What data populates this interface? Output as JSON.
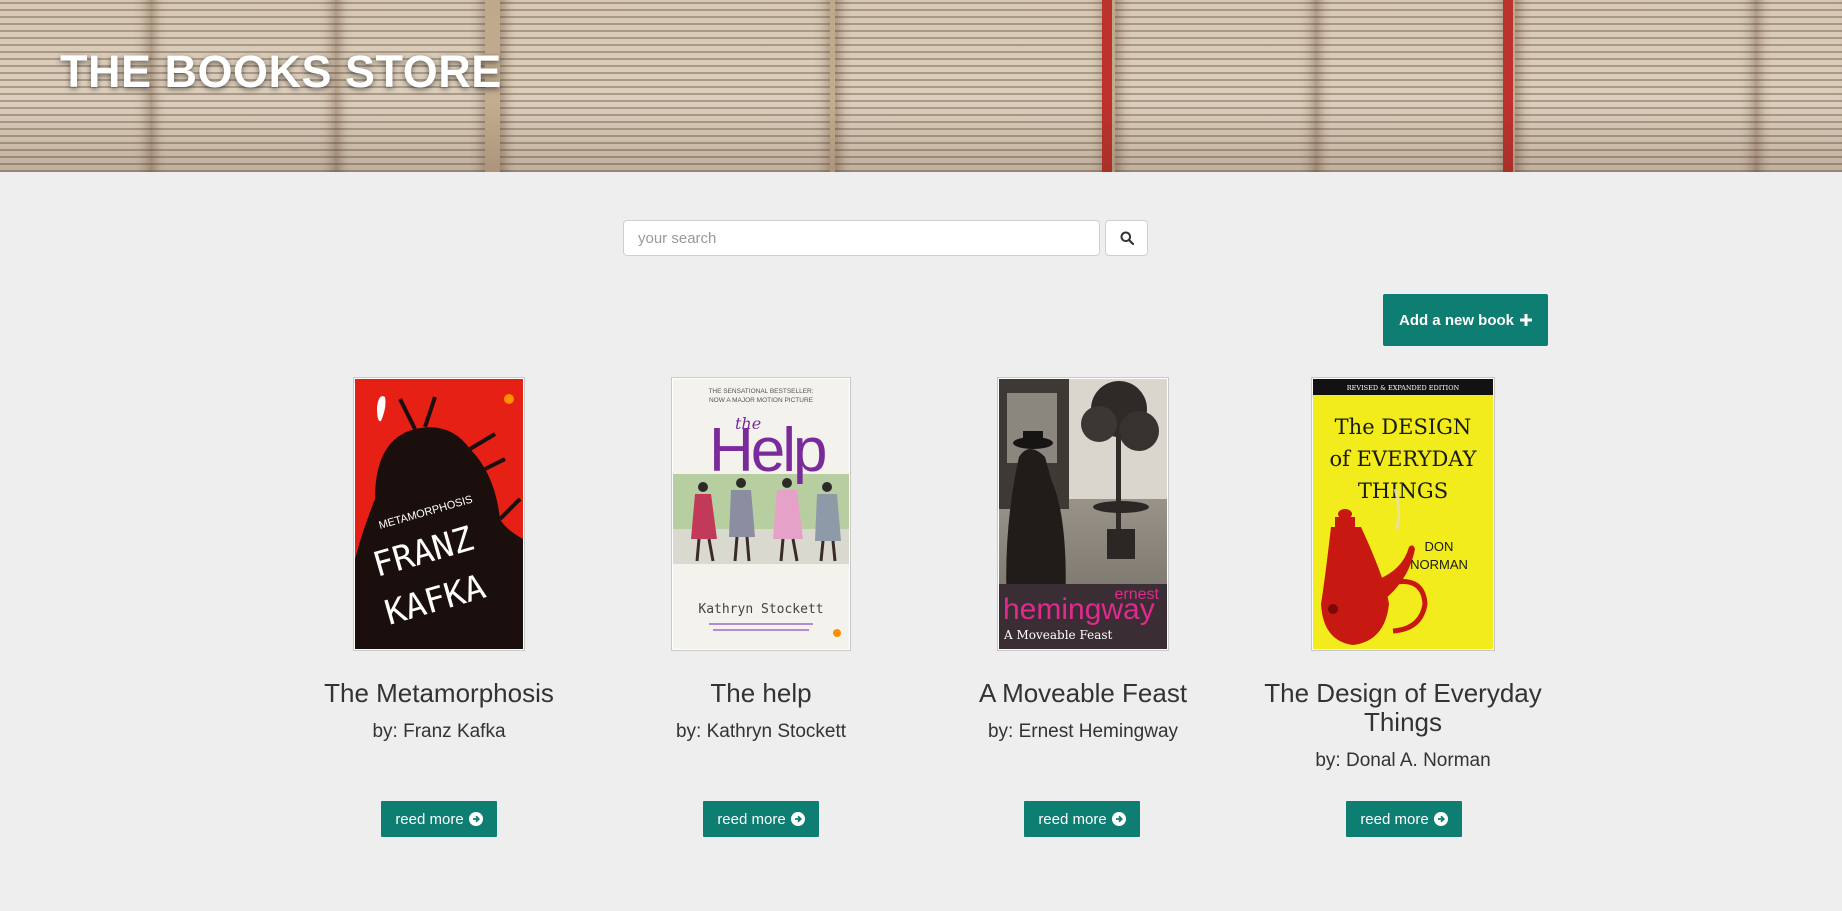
{
  "header": {
    "title": "THE BOOKS STORE"
  },
  "search": {
    "placeholder": "your search",
    "icon": "search-icon"
  },
  "actions": {
    "add_book_label": "Add a new book",
    "add_icon": "plus-icon"
  },
  "colors": {
    "accent": "#0e7d72",
    "page_background": "#eeeeee"
  },
  "books": [
    {
      "title": "The Metamorphosis",
      "author": "by: Franz Kafka",
      "button": "reed more",
      "cover": {
        "series_label": "METAMORPHOSIS",
        "author_line1": "FRANZ",
        "author_line2": "KAFKA"
      }
    },
    {
      "title": "The help",
      "author": "by: Kathryn Stockett",
      "button": "reed more",
      "cover": {
        "tagline1": "THE SENSATIONAL BESTSELLER:",
        "tagline2": "NOW A MAJOR MOTION PICTURE",
        "title_small": "the",
        "title_big": "Help",
        "author": "Kathryn Stockett"
      }
    },
    {
      "title": "A Moveable Feast",
      "author": "by: Ernest Hemingway",
      "button": "reed more",
      "cover": {
        "author_small": "ernest",
        "author_big": "hemingway",
        "title": "A Moveable Feast"
      }
    },
    {
      "title": "The Design of Everyday Things",
      "author": "by: Donal A. Norman",
      "button": "reed more",
      "cover": {
        "edition": "REVISED & EXPANDED EDITION",
        "line1": "The DESIGN",
        "line2": "of EVERYDAY",
        "line3": "THINGS",
        "author1": "DON",
        "author2": "NORMAN"
      }
    }
  ]
}
